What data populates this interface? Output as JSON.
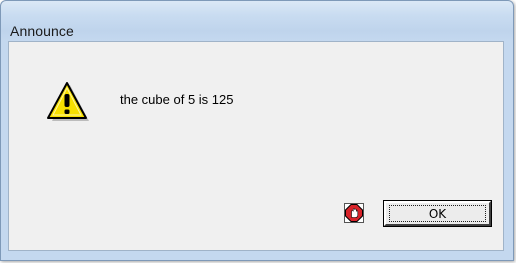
{
  "window": {
    "title": "Announce"
  },
  "dialog": {
    "message": "the cube of 5 is 125",
    "ok_label": "OK",
    "message_icon": "warning-icon",
    "stop_icon": "stop-hand-icon"
  },
  "colors": {
    "titlebar": "#c9dcf1",
    "client_background": "#f0f0f0",
    "warning_yellow": "#f7e000",
    "stop_red": "#d8232a"
  }
}
